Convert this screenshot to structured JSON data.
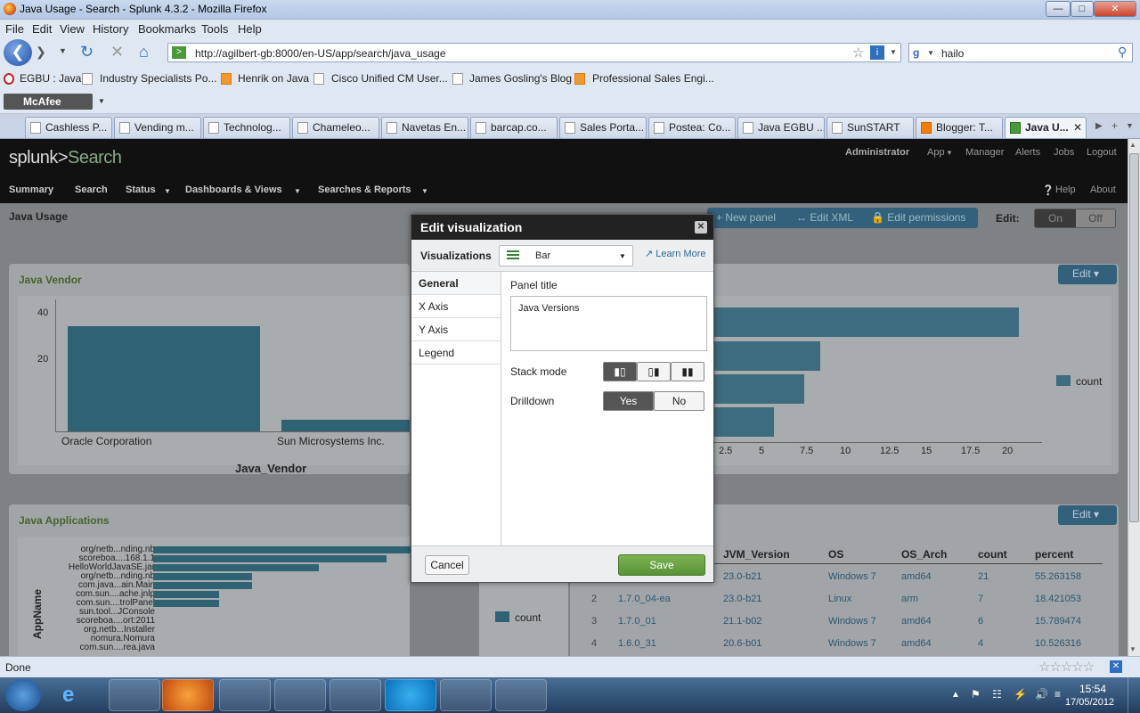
{
  "browser": {
    "title": "Java Usage - Search - Splunk 4.3.2 - Mozilla Firefox",
    "menu": [
      "File",
      "Edit",
      "View",
      "History",
      "Bookmarks",
      "Tools",
      "Help"
    ],
    "url": "http://agilbert-gb:8000/en-US/app/search/java_usage",
    "search_value": "hailo",
    "bookmarks": [
      "EGBU : Java",
      "Industry Specialists Po...",
      "Henrik on Java",
      "Cisco Unified CM User...",
      "James Gosling's Blog",
      "Professional Sales Engi..."
    ],
    "mcafee": "McAfee",
    "tabs": [
      "Cashless P...",
      "Vending m...",
      "Technolog...",
      "Chameleo...",
      "Navetas En...",
      "barcap.co...",
      "Sales Porta...",
      "Postea: Co...",
      "Java EGBU ...",
      "SunSTART",
      "Blogger: T...",
      "Java U..."
    ],
    "status": "Done"
  },
  "splunk": {
    "logo": "splunk>",
    "app": "Search",
    "top_links": [
      "Administrator",
      "App",
      "Manager",
      "Alerts",
      "Jobs",
      "Logout"
    ],
    "nav": [
      "Summary",
      "Search",
      "Status",
      "Dashboards & Views",
      "Searches & Reports"
    ],
    "help": "Help",
    "about": "About",
    "page_title": "Java Usage",
    "actions": [
      "New panel",
      "Edit XML",
      "Edit permissions"
    ],
    "edit_label": "Edit:",
    "edit_on": "On",
    "edit_off": "Off",
    "edit": "Edit"
  },
  "panels": {
    "vendor": {
      "title": "Java Vendor",
      "xlabel": "Java_Vendor",
      "yticks": [
        "40",
        "20"
      ],
      "categories": [
        "Oracle Corporation",
        "Sun Microsystems Inc."
      ]
    },
    "versions": {
      "legend": "count",
      "xticks": [
        "2.5",
        "5",
        "7.5",
        "10",
        "12.5",
        "15",
        "17.5",
        "20"
      ]
    },
    "apps": {
      "title": "Java Applications",
      "ylabel": "AppName",
      "legend": "count",
      "names": [
        "org/netb...nding.nb",
        "scoreboa....168.1.1",
        "HelloWorldJavaSE.jar",
        "org/netb...nding.nb",
        "com.java...ain.Main",
        "com.sun....ache.jnlp",
        "com.sun....trolPanel",
        "sun.tool...JConsole",
        "scoreboa....ort:2011",
        "org.netb...Installer",
        "nomura.Nomura",
        "com.sun....rea.java"
      ]
    },
    "table": {
      "headers": [
        "JVM_Version",
        "OS",
        "OS_Arch",
        "count",
        "percent"
      ],
      "rows": [
        {
          "n": "",
          "v": "",
          "jvm": "23.0-b21",
          "os": "Windows 7",
          "arch": "amd64",
          "count": "21",
          "pct": "55.263158"
        },
        {
          "n": "2",
          "v": "1.7.0_04-ea",
          "jvm": "23.0-b21",
          "os": "Linux",
          "arch": "arm",
          "count": "7",
          "pct": "18.421053"
        },
        {
          "n": "3",
          "v": "1.7.0_01",
          "jvm": "21.1-b02",
          "os": "Windows 7",
          "arch": "amd64",
          "count": "6",
          "pct": "15.789474"
        },
        {
          "n": "4",
          "v": "1.6.0_31",
          "jvm": "20.6-b01",
          "os": "Windows 7",
          "arch": "amd64",
          "count": "4",
          "pct": "10.526316"
        }
      ]
    }
  },
  "modal": {
    "title": "Edit visualization",
    "vis_label": "Visualizations",
    "vis_value": "Bar",
    "learn_more": "Learn More",
    "sections": [
      "General",
      "X Axis",
      "Y Axis",
      "Legend"
    ],
    "panel_title_label": "Panel title",
    "panel_title_value": "Java Versions",
    "stack_label": "Stack mode",
    "drilldown_label": "Drilldown",
    "yes": "Yes",
    "no": "No",
    "cancel": "Cancel",
    "save": "Save"
  },
  "taskbar": {
    "time": "15:54",
    "date": "17/05/2012"
  },
  "chart_data": [
    {
      "type": "bar",
      "title": "Java Vendor",
      "xlabel": "Java_Vendor",
      "categories": [
        "Oracle Corporation",
        "Sun Microsystems Inc."
      ],
      "values": [
        36,
        4
      ],
      "ylim": [
        0,
        45
      ]
    },
    {
      "type": "bar",
      "title": "Java Versions",
      "orientation": "horizontal",
      "values": [
        21,
        7,
        6,
        4
      ],
      "xlim": [
        0,
        22.5
      ],
      "legend": "count"
    }
  ]
}
